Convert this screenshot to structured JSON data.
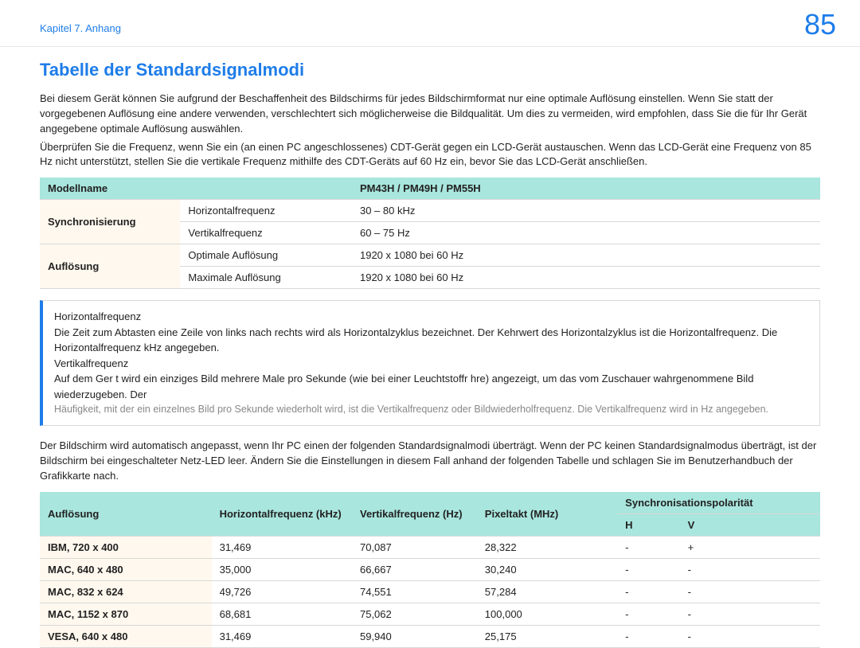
{
  "header": {
    "chapter": "Kapitel 7. Anhang",
    "page_num": "85"
  },
  "title": "Tabelle der Standardsignalmodi",
  "intro_p1": "Bei diesem Gerät können Sie aufgrund der Beschaffenheit des Bildschirms für jedes Bildschirmformat nur eine optimale Auflösung einstellen. Wenn Sie statt der vorgegebenen Auflösung eine andere verwenden, verschlechtert sich möglicherweise die Bildqualität. Um dies zu vermeiden, wird empfohlen, dass Sie die für Ihr Gerät angegebene optimale Auflösung auswählen.",
  "intro_p2": "Überprüfen Sie die Frequenz, wenn Sie ein (an einen PC angeschlossenes) CDT-Gerät gegen ein LCD-Gerät austauschen. Wenn das LCD-Gerät eine Frequenz von 85 Hz nicht unterstützt, stellen Sie die vertikale Frequenz mithilfe des CDT-Geräts auf 60 Hz ein, bevor Sie das LCD-Gerät anschließen.",
  "table1": {
    "h1": "Modellname",
    "h2": "PM43H / PM49H / PM55H",
    "r1c1": "Synchronisierung",
    "r1c2": "Horizontalfrequenz",
    "r1c3": "30 – 80 kHz",
    "r2c2": "Vertikalfrequenz",
    "r2c3": "60 – 75 Hz",
    "r3c1": "Auflösung",
    "r3c2": "Optimale Auflösung",
    "r3c3": "1920 x 1080 bei 60 Hz",
    "r4c2": "Maximale Auflösung",
    "r4c3": "1920 x 1080 bei 60 Hz"
  },
  "note": {
    "h_label": "Horizontalfrequenz",
    "h_text": "Die Zeit zum Abtasten eine Zeile von links nach rechts wird als Horizontalzyklus bezeichnet. Der Kehrwert des Horizontalzyklus ist die Horizontalfrequenz. Die Horizontalfrequenz kHz angegeben.",
    "v_label": "Vertikalfrequenz",
    "v_text": "Auf dem Ger t wird ein einziges Bild mehrere Male pro Sekunde (wie bei einer Leuchtstoffr hre) angezeigt, um das vom Zuschauer wahrgenommene Bild wiederzugeben. Der",
    "v_sub": "Häufigkeit, mit der ein einzelnes Bild pro Sekunde wiederholt wird, ist die Vertikalfrequenz oder Bildwiederholfrequenz. Die Vertikalfrequenz wird in Hz angegeben."
  },
  "after_note": "Der Bildschirm wird automatisch angepasst, wenn Ihr PC einen der folgenden Standardsignalmodi überträgt. Wenn der PC keinen Standardsignalmodus überträgt, ist der Bildschirm bei eingeschalteter Netz-LED leer. Ändern Sie die Einstellungen in diesem Fall anhand der folgenden Tabelle und schlagen Sie im Benutzerhandbuch der Grafikkarte nach.",
  "table2": {
    "head": {
      "c1": "Auflösung",
      "c2": "Horizontalfrequenz (kHz)",
      "c3": "Vertikalfrequenz (Hz)",
      "c4": "Pixeltakt (MHz)",
      "c5": "Synchronisationspolarität",
      "c5a": "H",
      "c5b": "V"
    },
    "rows": [
      {
        "c1": "IBM, 720 x 400",
        "c2": "31,469",
        "c3": "70,087",
        "c4": "28,322",
        "c5a": "-",
        "c5b": "+"
      },
      {
        "c1": "MAC, 640 x 480",
        "c2": "35,000",
        "c3": "66,667",
        "c4": "30,240",
        "c5a": "-",
        "c5b": "-"
      },
      {
        "c1": "MAC, 832 x 624",
        "c2": "49,726",
        "c3": "74,551",
        "c4": "57,284",
        "c5a": "-",
        "c5b": "-"
      },
      {
        "c1": "MAC, 1152 x 870",
        "c2": "68,681",
        "c3": "75,062",
        "c4": "100,000",
        "c5a": "-",
        "c5b": "-"
      },
      {
        "c1": "VESA, 640 x 480",
        "c2": "31,469",
        "c3": "59,940",
        "c4": "25,175",
        "c5a": "-",
        "c5b": "-"
      }
    ]
  }
}
